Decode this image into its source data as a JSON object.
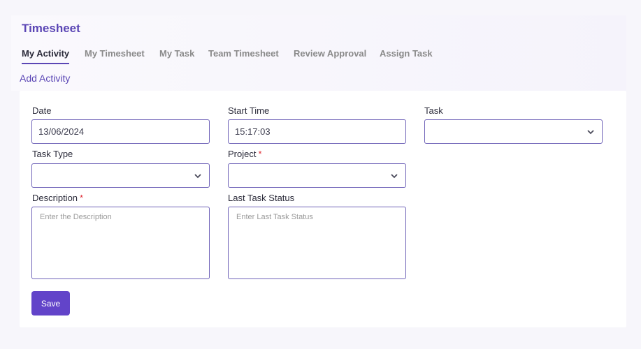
{
  "page": {
    "title": "Timesheet"
  },
  "tabs": [
    {
      "label": "My Activity"
    },
    {
      "label": "My Timesheet"
    },
    {
      "label": "My Task"
    },
    {
      "label": "Team Timesheet"
    },
    {
      "label": "Review Approval"
    },
    {
      "label": "Assign Task"
    }
  ],
  "active_tab": "My Activity",
  "add_activity": "Add Activity",
  "form": {
    "date_label": "Date",
    "date_value": "13/06/2024",
    "start_time_label": "Start Time",
    "start_time_value": "15:17:03",
    "task_label": "Task",
    "task_value": "",
    "task_type_label": "Task Type",
    "task_type_value": "",
    "project_label": "Project",
    "project_required": "*",
    "project_value": "",
    "description_label": "Description",
    "description_required": "*",
    "description_placeholder": "Enter the Description",
    "last_status_label": "Last Task Status",
    "last_status_placeholder": "Enter Last Task Status",
    "save_label": "Save"
  },
  "colors": {
    "accent": "#5b46b5",
    "button": "#6244c9",
    "required": "#e0303a"
  }
}
